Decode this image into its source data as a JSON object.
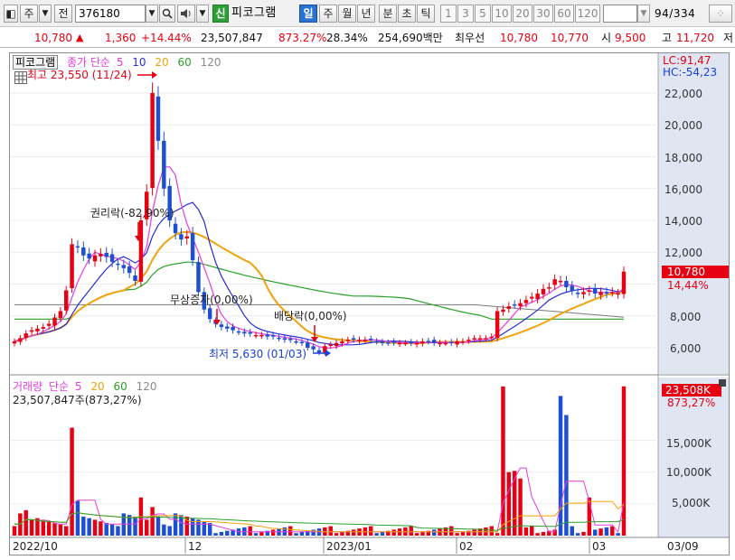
{
  "toolbar": {
    "period_prefix": "주",
    "total_label": "전",
    "code": "376180",
    "new_badge": "신",
    "stock_name": "피코그램",
    "period_tabs": [
      "일",
      "주",
      "월",
      "년",
      "분",
      "초",
      "틱"
    ],
    "active_period": "일",
    "intervals": [
      "1",
      "3",
      "5",
      "10",
      "20",
      "30",
      "60",
      "120"
    ],
    "page_indicator": "94/334",
    "count_field": ""
  },
  "quote": {
    "price": "10,780",
    "direction": "▲",
    "change": "1,360",
    "change_pct": "+14.44%",
    "volume": "23,507,847",
    "volume_ratio": "873.27%",
    "turnover": "28.34%",
    "amount": "254,690백만",
    "best_ask_label": "최우선",
    "best_ask": "10,780",
    "best_bid": "10,770",
    "open_label": "시",
    "open": "9,500",
    "high_label": "고",
    "high": "11,720",
    "low_label": "저"
  },
  "price_panel": {
    "legend_title": "피코그램",
    "legend_ma_label": "종가 단순",
    "legend_ma_periods": [
      "5",
      "10",
      "20",
      "60",
      "120"
    ],
    "lc_label": "LC:91,47",
    "hc_label": "HC:-54,23",
    "last_price_badge": "10,780",
    "last_change_pct": "14,44%",
    "high_annotation": "최고 23,550 (11/24)",
    "low_annotation": "최저 5,630 (01/03)",
    "rights_annotation": "권리락(-82,90%)",
    "bonus_annotation": "무상증자(0,00%)",
    "dividend_annotation": "배당락(0,00%)",
    "y_ticks": [
      "22,000",
      "20,000",
      "18,000",
      "16,000",
      "14,000",
      "12,000",
      "8,000",
      "6,000"
    ]
  },
  "volume_panel": {
    "legend_title": "거래량",
    "legend_ma_label": "단순",
    "legend_ma_periods": [
      "5",
      "20",
      "60",
      "120"
    ],
    "current_volume": "23,507,847주(873,27%)",
    "last_volume_badge": "23,508K",
    "last_volume_pct": "873,27%",
    "y_ticks": [
      "15,000K",
      "10,000K",
      "5,000K"
    ]
  },
  "x_axis": {
    "labels": [
      "2022/10",
      "12",
      "2023/01",
      "02",
      "03",
      "03/09"
    ]
  },
  "colors": {
    "up": "#e60012",
    "down": "#1f4fd1",
    "ma5": "#e53de3",
    "ma10": "#2b2bd8",
    "ma20": "#f0a30a",
    "ma60": "#2aa02a",
    "ma120": "#7a7a7a",
    "axis_panel": "#dfe6f2"
  },
  "chart_data": {
    "type": "candlestick",
    "price_range": [
      5000,
      24500
    ],
    "volume_range": [
      0,
      25000000
    ],
    "x_labels": [
      "2022/10",
      "12",
      "2023/01",
      "02",
      "03"
    ],
    "last_close": 10780,
    "period_high": 23550,
    "period_low": 5630,
    "last_volume": 23507847
  }
}
